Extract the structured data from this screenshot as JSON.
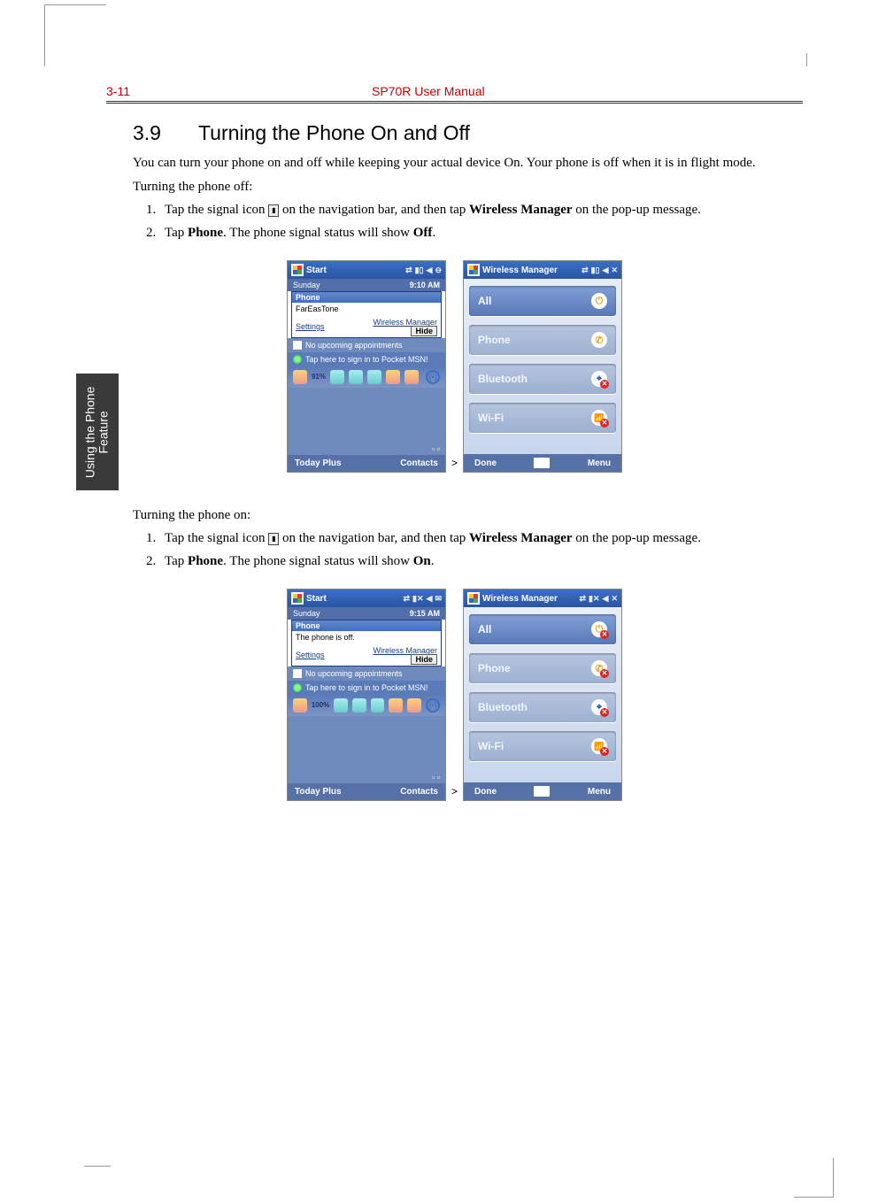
{
  "page": {
    "number": "3-11",
    "manual_title": "SP70R User Manual",
    "side_tab": "Using the Phone\nFeature"
  },
  "section": {
    "number": "3.9",
    "title": "Turning the Phone On and Off",
    "intro": "You can turn your phone on and off while keeping your actual device On. Your phone is off when it is in flight mode.",
    "off_intro": "Turning the phone off:",
    "off_steps": {
      "s1a": "Tap the signal icon ",
      "s1b": " on the navigation bar, and then tap ",
      "s1c": "Wireless Manager",
      "s1d": " on the pop-up message.",
      "s2a": "Tap ",
      "s2b": "Phone",
      "s2c": ". The phone signal status will show ",
      "s2d": "Off",
      "s2e": "."
    },
    "on_intro": "Turning the phone on:",
    "on_steps": {
      "s1a": "Tap the signal icon ",
      "s1b": " on the navigation bar, and then tap ",
      "s1c": "Wireless Manager",
      "s1d": " on the pop-up message.",
      "s2a": "Tap ",
      "s2b": "Phone",
      "s2c": ". The phone signal status will show ",
      "s2d": "On",
      "s2e": "."
    }
  },
  "fig_separator": ">",
  "device_off": {
    "left": {
      "start": "Start",
      "time": "9:10 AM",
      "day": "Sunday",
      "popup_title": "Phone",
      "carrier": "FarEasTone",
      "wm_link": "Wireless Manager",
      "settings": "Settings",
      "hide": "Hide",
      "no_appt": "No upcoming appointments",
      "msn": "Tap here to sign in to Pocket MSN!",
      "pct": "91%",
      "bl": "Today Plus",
      "br": "Contacts"
    },
    "right": {
      "title": "Wireless Manager",
      "all": "All",
      "phone": "Phone",
      "bt": "Bluetooth",
      "wifi": "Wi-Fi",
      "done": "Done",
      "menu": "Menu"
    }
  },
  "device_on": {
    "left": {
      "start": "Start",
      "time": "9:15 AM",
      "day": "Sunday",
      "popup_title": "Phone",
      "status": "The phone is off.",
      "wm_link": "Wireless Manager",
      "settings": "Settings",
      "hide": "Hide",
      "no_appt": "No upcoming appointments",
      "msn": "Tap here to sign in to Pocket MSN!",
      "pct": "100%",
      "bl": "Today Plus",
      "br": "Contacts"
    },
    "right": {
      "title": "Wireless Manager",
      "all": "All",
      "phone": "Phone",
      "bt": "Bluetooth",
      "wifi": "Wi-Fi",
      "done": "Done",
      "menu": "Menu"
    }
  }
}
